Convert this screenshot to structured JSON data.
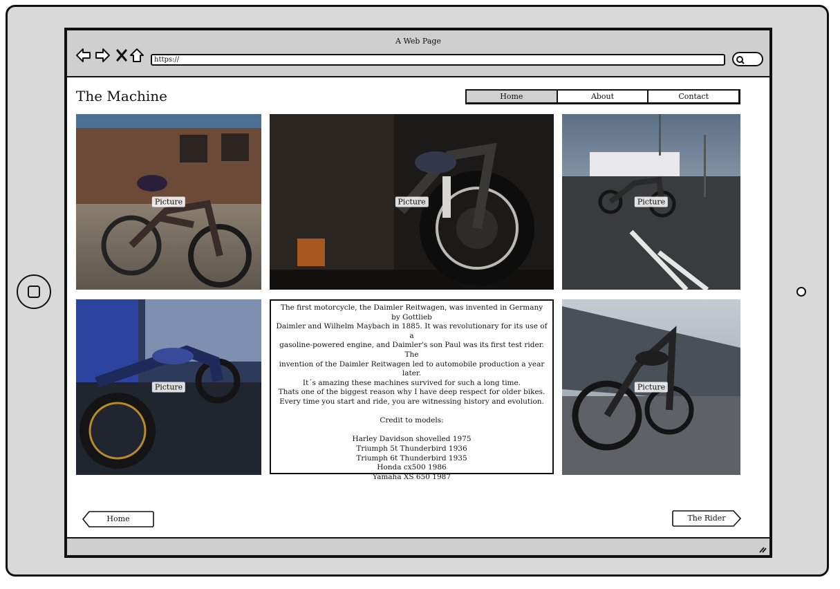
{
  "window": {
    "title": "A Web Page",
    "url": "https://",
    "icons": [
      "back-arrow-icon",
      "forward-arrow-icon",
      "close-x-icon",
      "home-icon",
      "search-icon"
    ]
  },
  "site": {
    "title": "The Machine"
  },
  "nav": {
    "items": [
      "Home",
      "About",
      "Contact"
    ],
    "active": "Home"
  },
  "gallery": {
    "picture_label": "Picture"
  },
  "article": {
    "lines": [
      "The first motorcycle, the Daimler Reitwagen, was invented in Germany by Gottlieb",
      "Daimler and Wilhelm Maybach in 1885. It was revolutionary for its use of a",
      "gasoline-powered engine, and Daimler's son Paul was its first test rider. The",
      "invention of the Daimler Reitwagen led to automobile production a year later.",
      "It´s amazing these machines survived for such a long time.",
      "Thats one of the biggest reason why I have deep respect for older bikes.",
      "Every time you start and ride,  you are witnessing history and evolution."
    ],
    "credit_heading": "Credit to models:",
    "credits": [
      "Harley Davidson shovelled 1975",
      "Triumph 5t Thunderbird 1936",
      "Triumph 6t Thunderbird 1935",
      "Honda cx500 1986",
      "Yamaha XS 650 1987"
    ]
  },
  "footer": {
    "prev_label": "Home",
    "next_label": "The Rider"
  }
}
